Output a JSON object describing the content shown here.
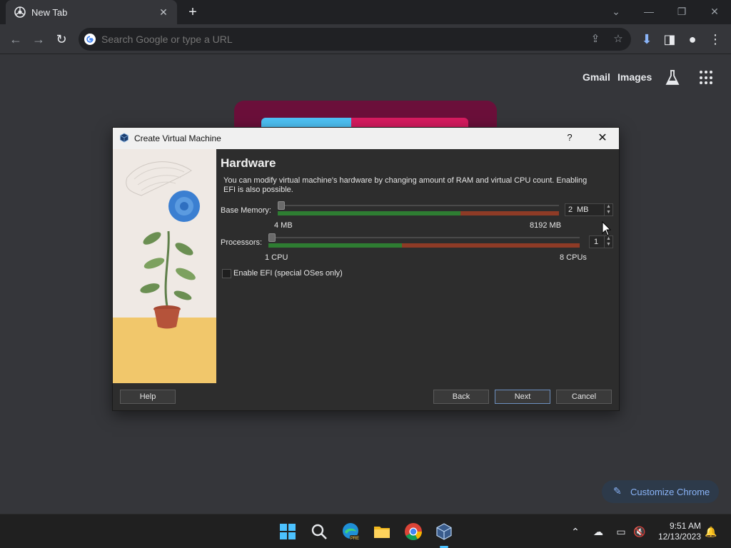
{
  "browser": {
    "tab_title": "New Tab",
    "omnibox_placeholder": "Search Google or type a URL",
    "ntp_links": [
      "Gmail",
      "Images"
    ],
    "customize_label": "Customize Chrome"
  },
  "dialog": {
    "title": "Create Virtual Machine",
    "help_glyph": "?",
    "heading": "Hardware",
    "description": "You can modify virtual machine's hardware by changing amount of RAM and virtual CPU count. Enabling EFI is also possible.",
    "memory": {
      "label": "Base Memory:",
      "min_label": "4 MB",
      "max_label": "8192 MB",
      "value": "2",
      "unit": "MB",
      "slider_fraction": 0.0,
      "green_fraction": 0.65
    },
    "processors": {
      "label": "Processors:",
      "min_label": "1 CPU",
      "max_label": "8 CPUs",
      "value": "1",
      "slider_fraction": 0.0,
      "green_fraction": 0.43
    },
    "efi_label": "Enable EFI (special OSes only)",
    "efi_checked": false,
    "buttons": {
      "help": "Help",
      "back": "Back",
      "next": "Next",
      "cancel": "Cancel"
    }
  },
  "taskbar": {
    "time": "9:51 AM",
    "date": "12/13/2023",
    "apps": [
      "start-icon",
      "search-icon",
      "edge-icon",
      "file-explorer-icon",
      "chrome-icon",
      "virtualbox-icon"
    ]
  },
  "colors": {
    "accent": "#8ab4f8",
    "slider_green": "#2e7d32",
    "slider_red": "#8e3b26",
    "taskbar_indicator": "#4cc2ff"
  }
}
